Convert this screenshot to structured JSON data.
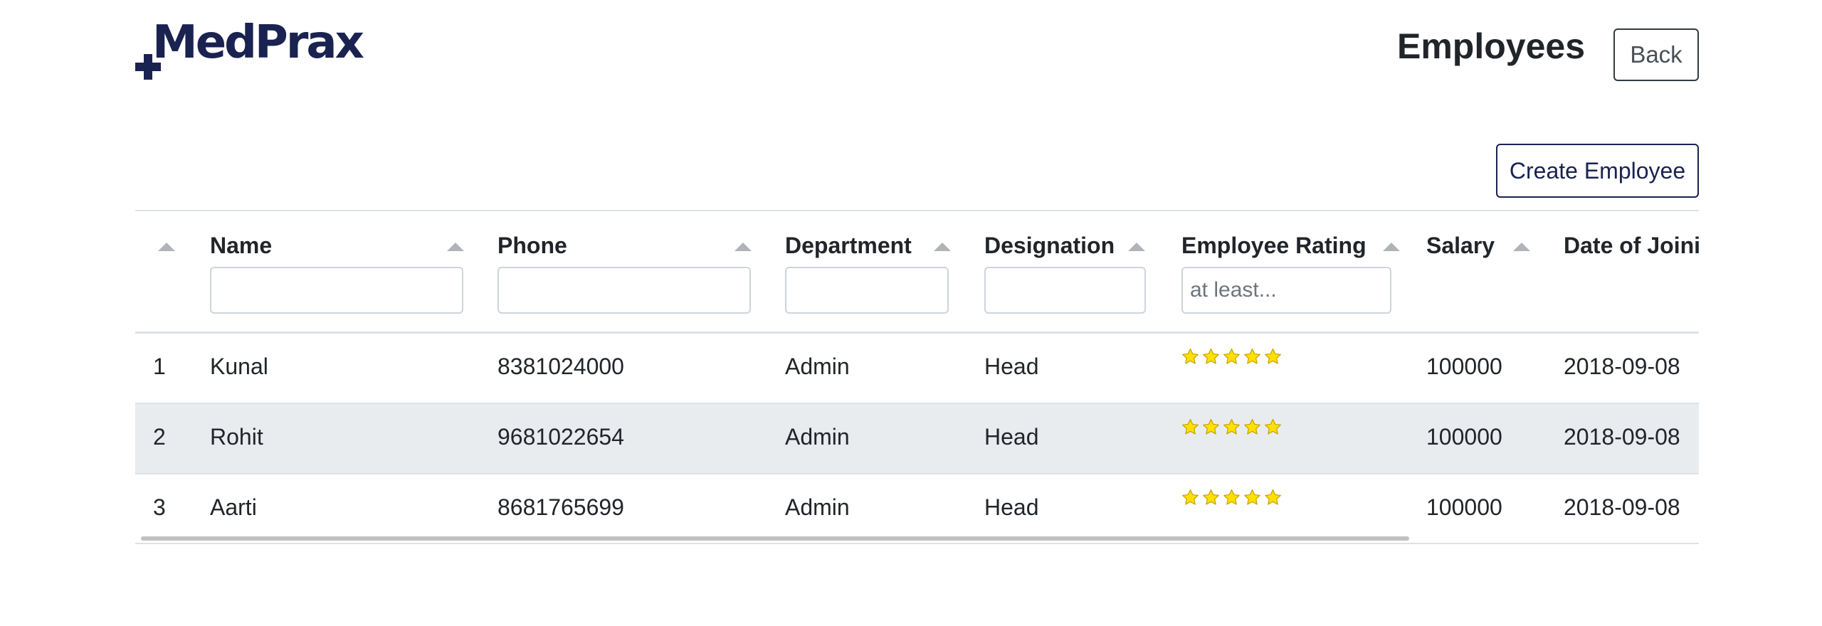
{
  "brand": {
    "name": "MedPrax",
    "color": "#1a2250"
  },
  "header": {
    "title": "Employees",
    "back_label": "Back"
  },
  "toolbar": {
    "create_label": "Create Employee"
  },
  "table": {
    "columns": [
      "",
      "Name",
      "Phone",
      "Department",
      "Designation",
      "Employee Rating",
      "Salary",
      "Date of Joining"
    ],
    "rating_filter_placeholder": "at least...",
    "rows": [
      {
        "index": "1",
        "name": "Kunal",
        "phone": "8381024000",
        "department": "Admin",
        "designation": "Head",
        "rating": 5,
        "salary": "100000",
        "doj": "2018-09-08"
      },
      {
        "index": "2",
        "name": "Rohit",
        "phone": "9681022654",
        "department": "Admin",
        "designation": "Head",
        "rating": 5,
        "salary": "100000",
        "doj": "2018-09-08"
      },
      {
        "index": "3",
        "name": "Aarti",
        "phone": "8681765699",
        "department": "Admin",
        "designation": "Head",
        "rating": 5,
        "salary": "100000",
        "doj": "2018-09-08"
      }
    ]
  },
  "colors": {
    "stripe": "#e9ecef",
    "border": "#dee2e6",
    "star_fill": "#ffe000",
    "star_stroke": "#c8a400",
    "sort_icon": "#b0b4b8"
  },
  "icons": {
    "sort": "sort-up-icon",
    "rating": "star-icon"
  }
}
